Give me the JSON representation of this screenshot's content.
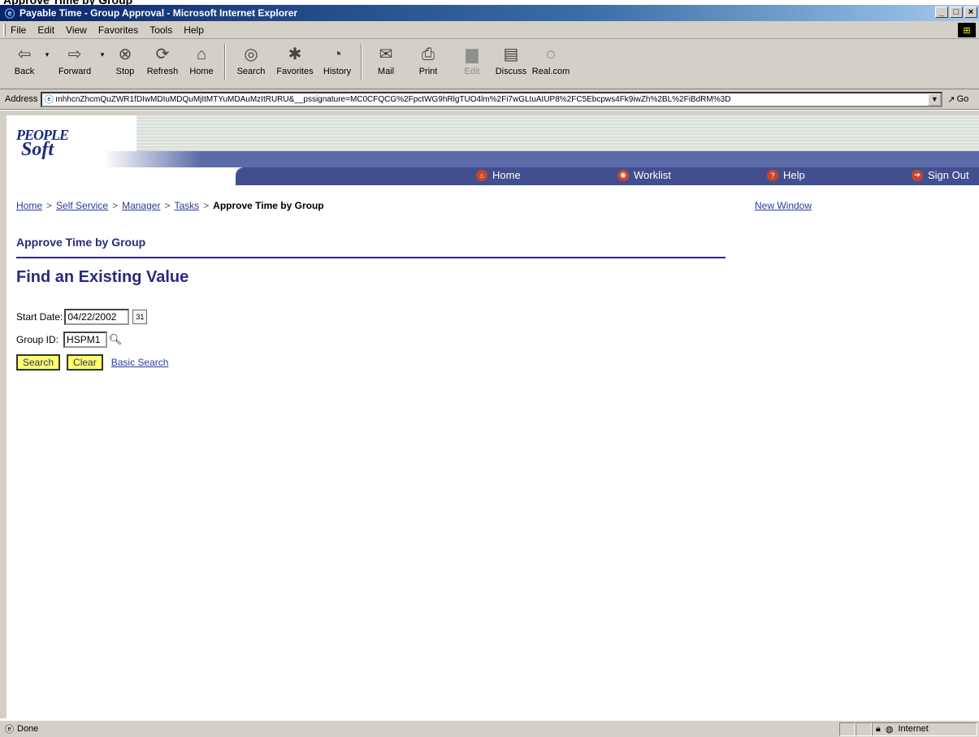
{
  "window": {
    "title": "Payable Time - Group Approval - Microsoft Internet Explorer",
    "top_crop_text": "Approve Time by Group",
    "buttons": {
      "minimize": "_",
      "maximize": "□",
      "close": "×"
    }
  },
  "menu": [
    "File",
    "Edit",
    "View",
    "Favorites",
    "Tools",
    "Help"
  ],
  "toolbar": {
    "back": "Back",
    "forward": "Forward",
    "stop": "Stop",
    "refresh": "Refresh",
    "home": "Home",
    "search": "Search",
    "favorites": "Favorites",
    "history": "History",
    "mail": "Mail",
    "print": "Print",
    "edit": "Edit",
    "discuss": "Discuss",
    "realcom": "Real.com"
  },
  "address": {
    "label": "Address",
    "url": "mhhcnZhcmQuZWR1fDIwMDIuMDQuMjItMTYuMDAuMzItRURU&__pssignature=MC0CFQCG%2FpctWG9hRlgTUO4lm%2Fi7wGLtuAIUP8%2FC5Ebcpws4Fk9iwZh%2BL%2FiBdRM%3D",
    "go": "Go"
  },
  "nav": {
    "home": "Home",
    "worklist": "Worklist",
    "help": "Help",
    "signout": "Sign Out"
  },
  "breadcrumb": {
    "home": "Home",
    "sep": ">",
    "self_service": "Self Service",
    "manager": "Manager",
    "tasks": "Tasks",
    "current": "Approve Time by Group"
  },
  "new_window": "New Window",
  "section_title": "Approve Time by Group",
  "heading": "Find an Existing Value",
  "form": {
    "start_date_label": "Start Date:",
    "start_date_value": "04/22/2002",
    "group_id_label": "Group ID:",
    "group_id_value": "HSPM1"
  },
  "buttons": {
    "search": "Search",
    "clear": "Clear",
    "basic_search": "Basic Search"
  },
  "status": {
    "done": "Done",
    "zone": "Internet"
  }
}
